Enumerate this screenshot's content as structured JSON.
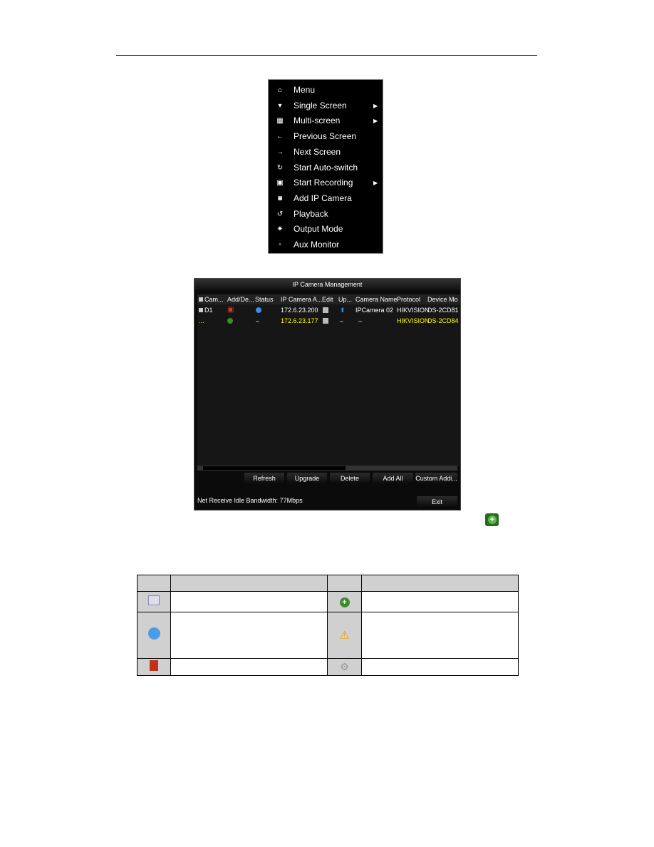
{
  "menu": {
    "items": [
      {
        "icon": "home-icon",
        "label": "Menu",
        "submenu": false
      },
      {
        "icon": "camera-icon",
        "label": "Single Screen",
        "submenu": true
      },
      {
        "icon": "multi-screen-icon",
        "label": "Multi-screen",
        "submenu": true
      },
      {
        "icon": "arrow-left-icon",
        "label": "Previous Screen",
        "submenu": false
      },
      {
        "icon": "arrow-right-icon",
        "label": "Next Screen",
        "submenu": false
      },
      {
        "icon": "refresh-icon",
        "label": "Start Auto-switch",
        "submenu": false
      },
      {
        "icon": "record-icon",
        "label": "Start Recording",
        "submenu": true
      },
      {
        "icon": "add-camera-icon",
        "label": "Add IP Camera",
        "submenu": false
      },
      {
        "icon": "playback-icon",
        "label": "Playback",
        "submenu": false
      },
      {
        "icon": "output-icon",
        "label": "Output Mode",
        "submenu": false
      },
      {
        "icon": "aux-monitor-icon",
        "label": "Aux Monitor",
        "submenu": false
      }
    ]
  },
  "ipcam": {
    "title": "IP Camera Management",
    "columns": [
      "Cam...",
      "Add/De...",
      "Status",
      "IP Camera A...",
      "Edit",
      "Up...",
      "Camera Name",
      "Protocol",
      "Device Mo"
    ],
    "rows": [
      {
        "cam": "D1",
        "ip": "172.6.23.200",
        "name": "IPCamera 02",
        "protocol": "HIKVISION",
        "model": "DS-2CD81"
      },
      {
        "cam": "...",
        "status": "–",
        "ip": "172.6.23.177",
        "upgrade": "–",
        "name": "–",
        "protocol": "HIKVISION",
        "model": "DS-2CD84"
      }
    ],
    "buttons": [
      "Refresh",
      "Upgrade",
      "Delete",
      "Add All",
      "Custom Addi..."
    ],
    "bandwidth": "Net Receive Idle Bandwidth: 77Mbps",
    "exit": "Exit"
  },
  "colors": {
    "highlight_row": "#ffff00",
    "add_green": "#3c8c2c",
    "status_blue": "#3a8de0",
    "delete_red": "#c0301c"
  }
}
